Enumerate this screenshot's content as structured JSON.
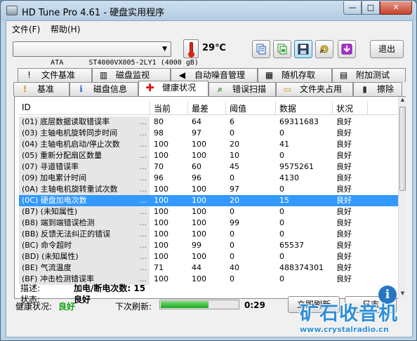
{
  "window": {
    "title": "HD Tune Pro 4.61 - 硬盘实用程序",
    "minimize": "—",
    "maximize": "□",
    "close": "✕"
  },
  "menu": [
    "文件(F)",
    "帮助(H)"
  ],
  "toolbar": {
    "drive": "ATA      ST4000VX005-2LY1 (4000 gB)",
    "temperature": "29℃",
    "exit_label": "退出",
    "icons": [
      "copy-text-icon",
      "copy-screenshot-icon",
      "save-icon",
      "options-icon",
      "download-icon"
    ]
  },
  "tabs_top": [
    {
      "label": "文件基准",
      "icon": "!"
    },
    {
      "label": "磁盘监视",
      "icon": "▥"
    },
    {
      "label": "自动噪音管理",
      "icon": "◀"
    },
    {
      "label": "随机存取",
      "icon": "▦"
    },
    {
      "label": "附加测试",
      "icon": "▤"
    }
  ],
  "tabs_bottom": [
    {
      "label": "基准",
      "icon": "!"
    },
    {
      "label": "磁盘信息",
      "icon": "i"
    },
    {
      "label": "健康状况",
      "icon": "✚"
    },
    {
      "label": "错误扫描",
      "icon": "⌕"
    },
    {
      "label": "文件夹占用",
      "icon": "▭"
    },
    {
      "label": "擦除",
      "icon": "▮"
    }
  ],
  "table": {
    "headers": [
      "ID",
      "当前",
      "最差",
      "阈值",
      "数据",
      "状况"
    ],
    "rows": [
      {
        "id": "(01) 底层数据读取错误率",
        "dots": "...",
        "current": "80",
        "worst": "64",
        "threshold": "6",
        "data": "69311683",
        "status": "良好"
      },
      {
        "id": "(03) 主轴电机旋转同步时间",
        "dots": "...",
        "current": "98",
        "worst": "97",
        "threshold": "0",
        "data": "0",
        "status": "良好"
      },
      {
        "id": "(04) 主轴电机启动/停止次数",
        "dots": "...",
        "current": "100",
        "worst": "100",
        "threshold": "20",
        "data": "41",
        "status": "良好"
      },
      {
        "id": "(05) 重新分配扇区数量",
        "dots": "...",
        "current": "100",
        "worst": "100",
        "threshold": "10",
        "data": "0",
        "status": "良好"
      },
      {
        "id": "(07) 寻道错误率",
        "dots": "...",
        "current": "70",
        "worst": "60",
        "threshold": "45",
        "data": "9575261",
        "status": "良好"
      },
      {
        "id": "(09) 加电累计时间",
        "dots": "...",
        "current": "96",
        "worst": "96",
        "threshold": "0",
        "data": "4130",
        "status": "良好"
      },
      {
        "id": "(0A) 主轴电机旋转重试次数",
        "dots": "...",
        "current": "100",
        "worst": "100",
        "threshold": "97",
        "data": "0",
        "status": "良好"
      },
      {
        "id": "(0C) 硬盘加电次数",
        "dots": "...",
        "current": "100",
        "worst": "100",
        "threshold": "20",
        "data": "15",
        "status": "良好",
        "selected": true
      },
      {
        "id": "(B7) (未知属性)",
        "dots": "...",
        "current": "100",
        "worst": "100",
        "threshold": "0",
        "data": "0",
        "status": "良好"
      },
      {
        "id": "(B8) 端到端错误检测",
        "dots": "...",
        "current": "100",
        "worst": "100",
        "threshold": "99",
        "data": "0",
        "status": "良好"
      },
      {
        "id": "(BB) 反馈无法纠正的错误",
        "dots": "...",
        "current": "100",
        "worst": "100",
        "threshold": "0",
        "data": "0",
        "status": "良好"
      },
      {
        "id": "(BC) 命令超时",
        "dots": "...",
        "current": "100",
        "worst": "99",
        "threshold": "0",
        "data": "65537",
        "status": "良好"
      },
      {
        "id": "(BD) (未知属性)",
        "dots": "...",
        "current": "100",
        "worst": "100",
        "threshold": "0",
        "data": "0",
        "status": "良好"
      },
      {
        "id": "(BE) 气流温度",
        "dots": "...",
        "current": "71",
        "worst": "44",
        "threshold": "40",
        "data": "488374301",
        "status": "良好"
      },
      {
        "id": "(BF) 冲击检测错误率",
        "dots": "...",
        "current": "100",
        "worst": "100",
        "threshold": "0",
        "data": "0",
        "status": "良好"
      }
    ]
  },
  "details": {
    "desc_label": "描述:",
    "desc_value": "加电/断电次数: 15",
    "status_label": "状态:",
    "status_value": "良好"
  },
  "footer": {
    "health_label": "健康状况:",
    "health_value": "良好",
    "refresh_label": "下次刷新:",
    "refresh_progress": 0.62,
    "countdown": "0:29",
    "refresh_button": "立即刷新",
    "log_button": "日志"
  },
  "watermark": {
    "text": "矿石收音机",
    "url": "www.crystalradio.cn",
    "info": "i"
  },
  "colors": {
    "selection": "#3399ff",
    "health_ok": "#10a010",
    "watermark": "#2e8fd6"
  }
}
